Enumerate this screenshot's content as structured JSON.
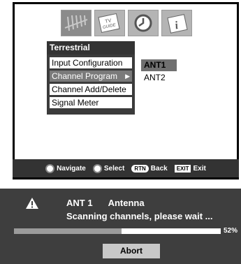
{
  "menu": {
    "header": "Terrestrial",
    "items": [
      "Input Configuration",
      "Channel Program",
      "Channel Add/Delete",
      "Signal Meter"
    ],
    "selected_index": 1,
    "icon_labels": {
      "tv_guide": "TV GUIDE"
    }
  },
  "submenu": {
    "items": [
      "ANT1",
      "ANT2"
    ],
    "selected_index": 0
  },
  "navbar": {
    "navigate": "Navigate",
    "select": "Select",
    "back_key": "RTN",
    "back": "Back",
    "exit_key": "EXIT",
    "exit": "Exit"
  },
  "scan": {
    "source": "ANT 1",
    "type": "Antenna",
    "status": "Scanning channels, please wait ...",
    "progress": 52,
    "progress_label": "52%",
    "abort_label": "Abort"
  },
  "colors": {
    "panel": "#3e3e3e",
    "selected": "#7a7a7a",
    "progress_fill": "#9b9b9b"
  }
}
